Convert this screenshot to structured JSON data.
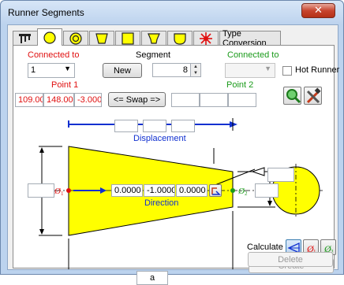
{
  "window": {
    "title": "Runner Segments",
    "close_glyph": "✕"
  },
  "tabs": [
    {
      "name": "segment-list",
      "icon": "runner-tree-icon"
    },
    {
      "name": "circle",
      "icon": "circle-shape-icon"
    },
    {
      "name": "double-circle",
      "icon": "double-circle-shape-icon"
    },
    {
      "name": "trapezoid",
      "icon": "trapezoid-shape-icon"
    },
    {
      "name": "rectangle",
      "icon": "square-shape-icon"
    },
    {
      "name": "wide-trapezoid",
      "icon": "trapezoid-wide-shape-icon"
    },
    {
      "name": "u-shape",
      "icon": "u-shape-icon"
    },
    {
      "name": "hot-runner",
      "icon": "hot-runner-burst-icon"
    },
    {
      "name": "type-conversion",
      "label": "Type Conversion"
    }
  ],
  "form": {
    "connected_to_left_label": "Connected to",
    "connected_to_left_value": "1",
    "segment_label": "Segment",
    "new_button": "New",
    "segment_value": "8",
    "connected_to_right_label": "Connected to",
    "connected_to_right_value": "",
    "hot_runner_label": "Hot Runner",
    "point1_label": "Point 1",
    "point2_label": "Point 2",
    "point1_x": "109.000",
    "point1_y": "148.000",
    "point1_z": "-3.000",
    "point2_x": "",
    "point2_y": "",
    "point2_z": "",
    "swap_button": "<= Swap =>"
  },
  "diagram": {
    "displacement_label": "Displacement",
    "displacement_values": [
      "",
      "",
      ""
    ],
    "direction_label": "Direction",
    "direction_values": [
      "0.0000",
      "-1.0000",
      "0.0000"
    ],
    "diameter1_symbol": "Ø",
    "diameter1_sub": "1",
    "diameter2_symbol": "Ø",
    "diameter2_sub": "2",
    "diameter1_value": "",
    "diameter2_value": "",
    "angle_value": "",
    "length_label": "a",
    "fill_color": "#ffff00",
    "point1_color": "#e01010",
    "point2_color": "#1a9a1a",
    "arrow_color": "#1030d0"
  },
  "actions": {
    "calculate_label": "Calculate",
    "create_button": "Create",
    "delete_button": "Delete"
  }
}
